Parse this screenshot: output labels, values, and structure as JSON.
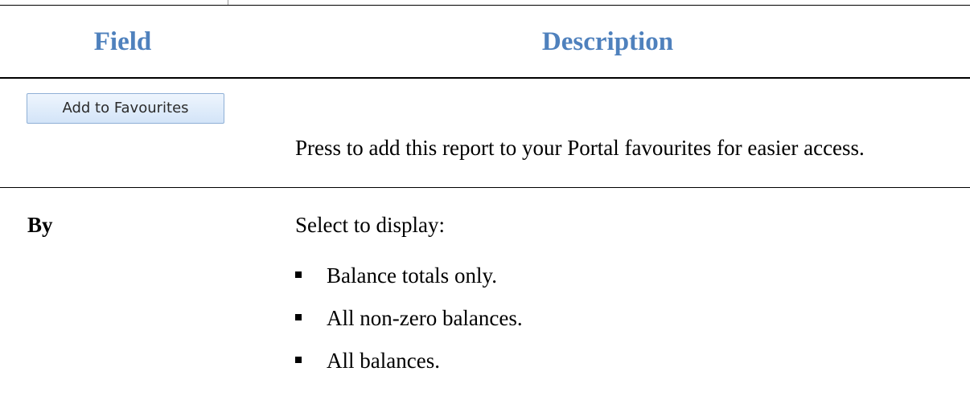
{
  "table": {
    "headers": {
      "field": "Field",
      "description": "Description"
    },
    "rows": [
      {
        "field_button_label": "Add to Favourites",
        "description": "Press to add this report to your Portal favourites for easier access."
      },
      {
        "field": "By",
        "description_intro": "Select to display:",
        "options": [
          "Balance totals only.",
          "All non-zero balances.",
          "All balances."
        ]
      }
    ]
  },
  "colors": {
    "header_text": "#4f81bd",
    "button_border": "#8fb0d6"
  },
  "icons": {
    "bullet": "square-bullet-icon"
  }
}
